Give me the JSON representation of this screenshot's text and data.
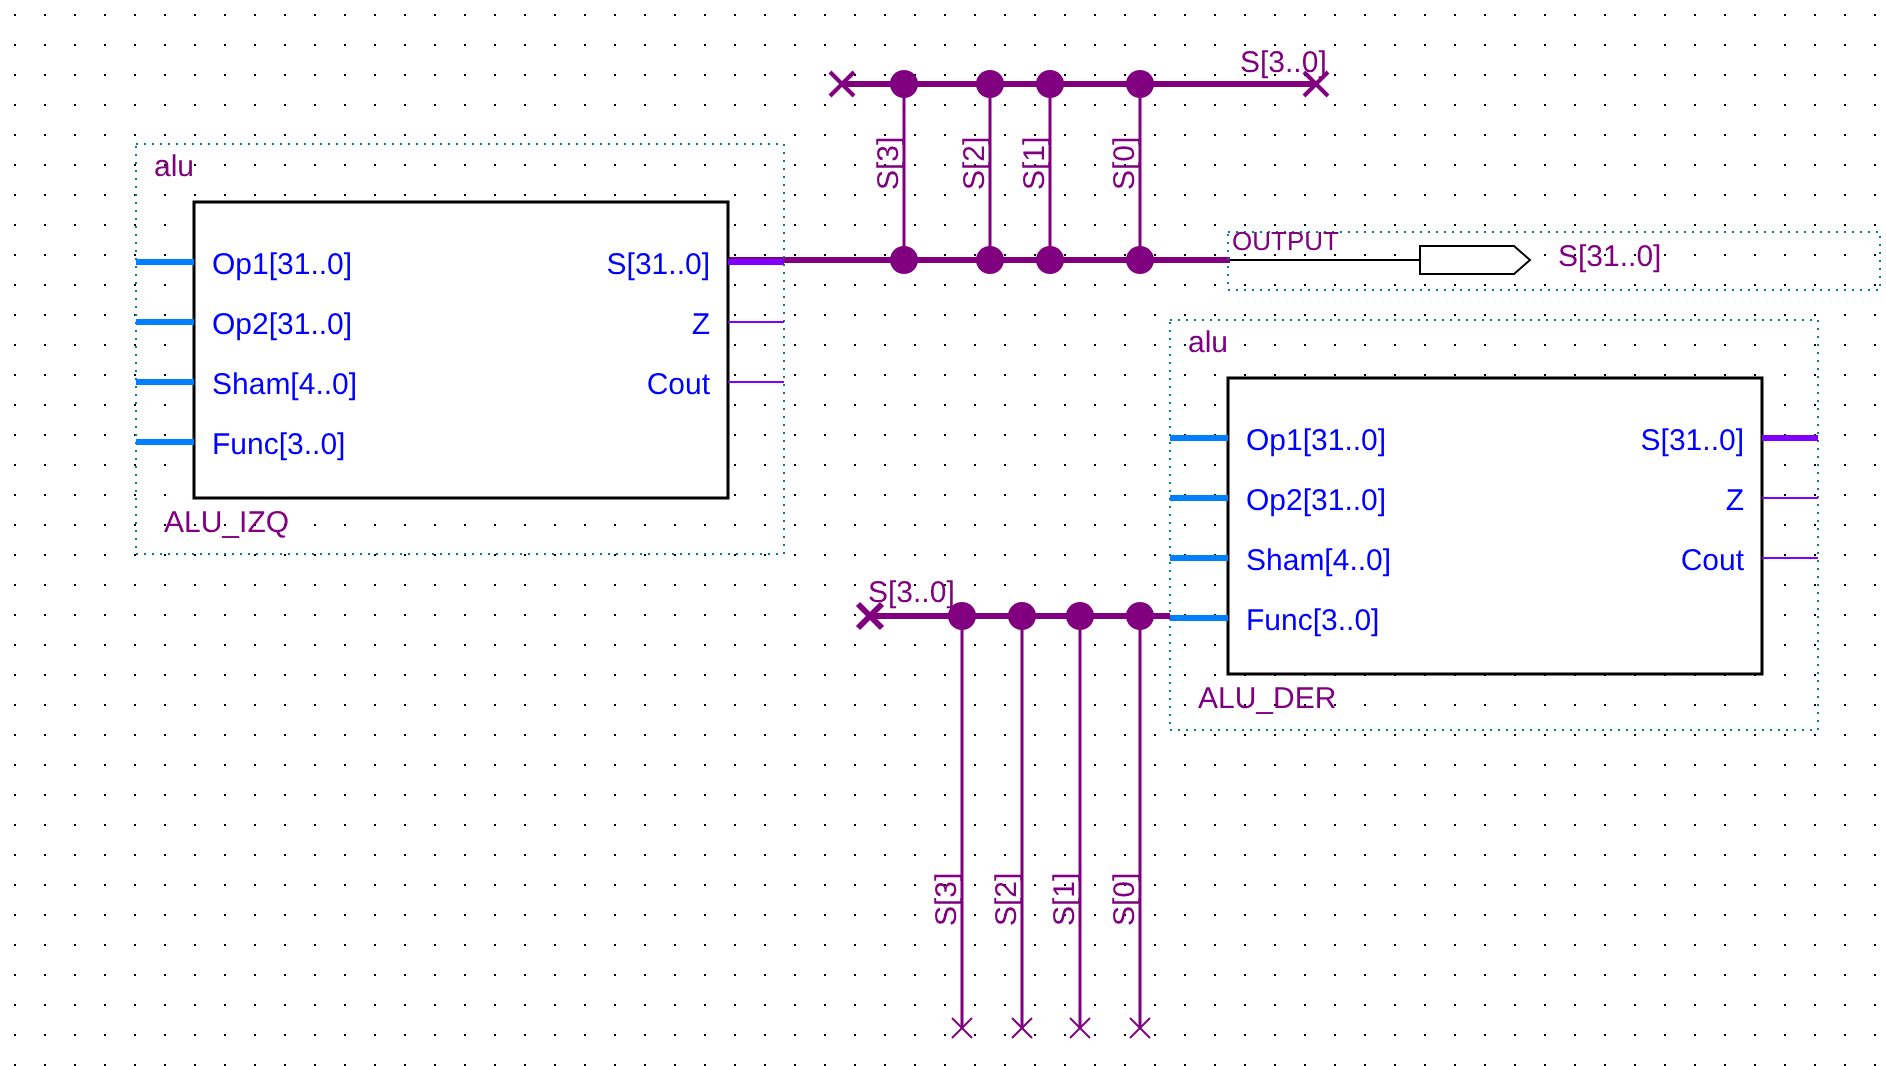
{
  "blocks": [
    {
      "type_label": "alu",
      "instance": "ALU_IZQ",
      "inputs": [
        "Op1[31..0]",
        "Op2[31..0]",
        "Sham[4..0]",
        "Func[3..0]"
      ],
      "outputs": [
        "S[31..0]",
        "Z",
        "Cout"
      ]
    },
    {
      "type_label": "alu",
      "instance": "ALU_DER",
      "inputs": [
        "Op1[31..0]",
        "Op2[31..0]",
        "Sham[4..0]",
        "Func[3..0]"
      ],
      "outputs": [
        "S[31..0]",
        "Z",
        "Cout"
      ]
    }
  ],
  "top_bus": {
    "label": "S[3..0]",
    "taps": [
      "S[3]",
      "S[2]",
      "S[1]",
      "S[0]"
    ]
  },
  "output_pin": {
    "name": "OUTPUT",
    "signal": "S[31..0]"
  },
  "bottom_bus": {
    "label": "S[3..0]",
    "taps": [
      "S[3]",
      "S[2]",
      "S[1]",
      "S[0]"
    ]
  }
}
